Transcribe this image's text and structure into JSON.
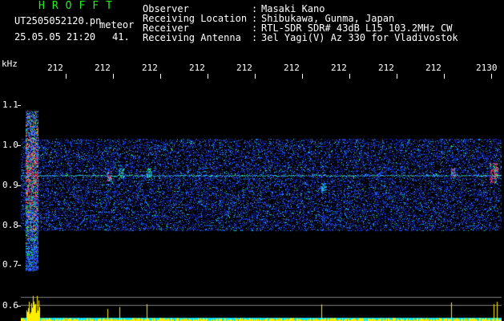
{
  "header": {
    "app_title": "HROFFT",
    "file_name": "UT2505052120.pn",
    "meteor_label": "meteor",
    "date_time": "25.05.05 21:20",
    "count": "41.",
    "axis_unit": "kHz"
  },
  "meta": [
    {
      "key": "Observer",
      "value": "Masaki Kano"
    },
    {
      "key": "Receiving Location",
      "value": "Shibukawa, Gunma, Japan"
    },
    {
      "key": "Receiver",
      "value": "RTL-SDR SDR# 43dB L15 103.2MHz CW"
    },
    {
      "key": "Receiving Antenna",
      "value": "3el Yagi(V) Az 330 for Vladivostok"
    }
  ],
  "x_ticks": [
    "212",
    "212",
    "212",
    "212",
    "212",
    "212",
    "212",
    "212",
    "212",
    "2130"
  ],
  "y_ticks": [
    "1.1",
    "1.0",
    "0.9",
    "0.8",
    "0.7",
    "0.6"
  ],
  "colors": {
    "background": "#000000",
    "title": "#22ee22",
    "band": "#1a2bd6",
    "echo": "#ff2a6a",
    "histogram": "#ffee00",
    "baseline": "#00e5ff"
  }
}
